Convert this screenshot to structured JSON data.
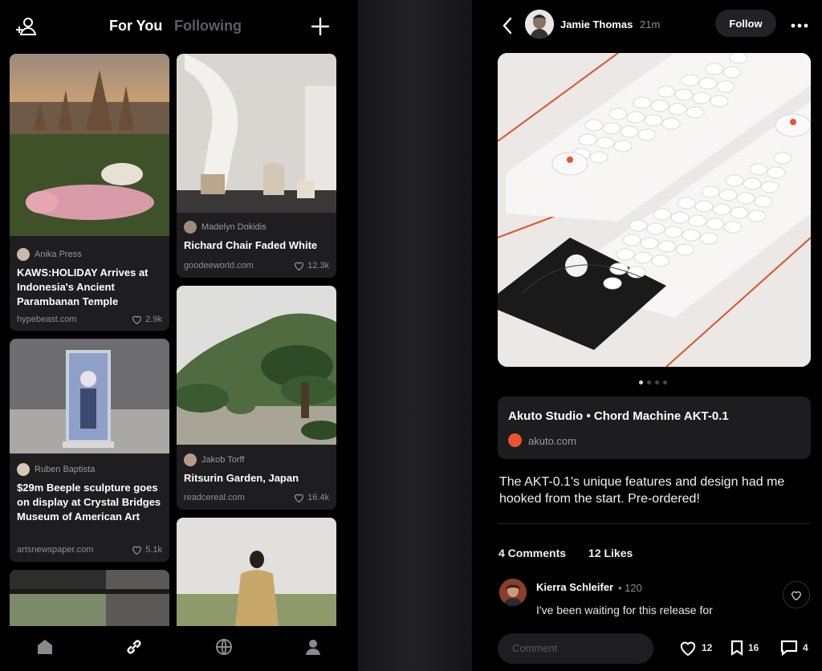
{
  "feed": {
    "tabs": [
      {
        "label": "For You",
        "active": true
      },
      {
        "label": "Following",
        "active": false
      }
    ],
    "cards": [
      {
        "author": "Anika Press",
        "title": "KAWS:HOLIDAY Arrives at Indonesia's Ancient Parambanan Temple",
        "domain": "hypebeast.com",
        "likes": "2.9k"
      },
      {
        "author": "Madelyn Dokidis",
        "title": "Richard Chair Faded White",
        "domain": "goodeeworld.com",
        "likes": "12.3k"
      },
      {
        "author": "Ruben Baptista",
        "title": "$29m Beeple sculpture goes on display at Crystal Bridges Museum of American Art",
        "domain": "artsnewspaper.com",
        "likes": "5.1k"
      },
      {
        "author": "Jakob Torff",
        "title": "Ritsurin Garden, Japan",
        "domain": "readcereal.com",
        "likes": "16.4k"
      }
    ]
  },
  "post": {
    "author": "Jamie Thomas",
    "time": "21m",
    "follow_label": "Follow",
    "link_title": "Akuto Studio • Chord Machine AKT-0.1",
    "link_domain": "akuto.com",
    "text": "The AKT-0.1's unique features and design had me hooked from the start. Pre-ordered!",
    "comments_label": "4 Comments",
    "likes_label": "12 Likes",
    "comment": {
      "author": "Kierra Schleifer",
      "score": "• 120",
      "text": "I've been waiting for this release for"
    },
    "comment_placeholder": "Comment",
    "actions": {
      "likes": "12",
      "saves": "16",
      "comments": "4"
    }
  },
  "icons": {
    "add_user": "add-user-icon",
    "add": "plus-icon",
    "home": "home-icon",
    "link": "link-icon",
    "globe": "globe-icon",
    "profile": "profile-icon",
    "back": "chevron-left-icon",
    "more": "more-icon"
  },
  "colors": {
    "background": "#000000",
    "accent": "#e9542e",
    "muted": "#5e5e62"
  }
}
